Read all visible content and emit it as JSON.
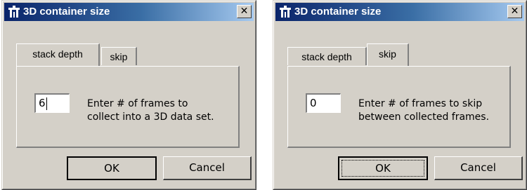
{
  "dialogs": [
    {
      "title": "3D container size",
      "close_label": "✕",
      "tabs": [
        "stack depth",
        "skip"
      ],
      "active_tab": "stack depth",
      "field_value": "6",
      "instructions": [
        "Enter  #  of frames to",
        "collect into a 3D data set."
      ],
      "ok_label": "OK",
      "cancel_label": "Cancel"
    },
    {
      "title": "3D container size",
      "close_label": "✕",
      "tabs": [
        "stack depth",
        "skip"
      ],
      "active_tab": "skip",
      "field_value": "0",
      "instructions": [
        "Enter  #  of frames to skip",
        "between collected frames."
      ],
      "ok_label": "OK",
      "cancel_label": "Cancel"
    }
  ],
  "colors": {
    "dialog_face": "#d4d0c8",
    "title_gradient_start": "#0a246a",
    "title_gradient_end": "#a6caf0",
    "title_text": "#ffffff"
  },
  "icons": {
    "title_icon": "tripod-stand-icon",
    "close": "close-icon"
  }
}
